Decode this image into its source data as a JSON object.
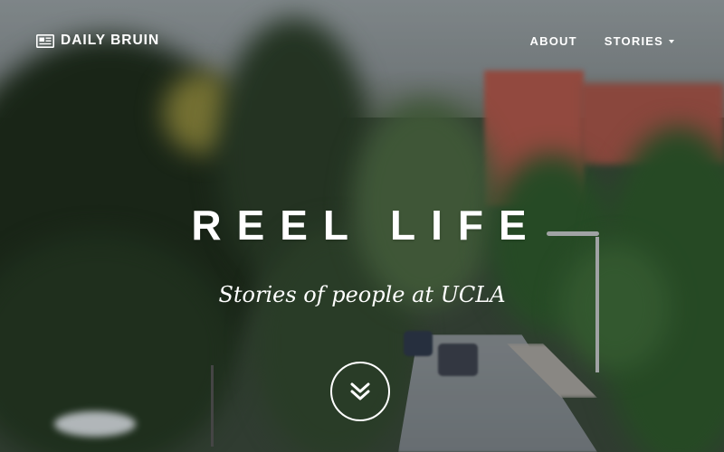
{
  "brand": {
    "name": "DAILY BRUIN",
    "icon": "newspaper-icon"
  },
  "nav": {
    "items": [
      {
        "label": "ABOUT"
      },
      {
        "label": "STORIES",
        "icon": "caret-down-icon"
      }
    ]
  },
  "hero": {
    "title": "REEL LIFE",
    "subtitle": "Stories of people at UCLA",
    "scroll_icon": "double-chevron-down-icon"
  },
  "colors": {
    "text": "#ffffff",
    "building": "#b25a4d",
    "foliage": "#2f4a2c"
  }
}
